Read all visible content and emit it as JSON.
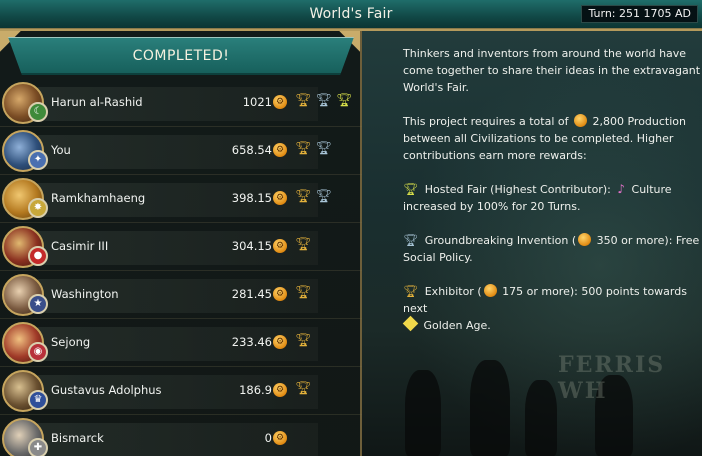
{
  "window": {
    "title": "World's Fair",
    "turn": "Turn: 251   1705 AD"
  },
  "banner": {
    "label": "COMPLETED!"
  },
  "civs": [
    {
      "name": "Harun al-Rashid",
      "score": "1021",
      "trophies": [
        "gold",
        "silver",
        "green"
      ]
    },
    {
      "name": "You",
      "score": "658.54",
      "trophies": [
        "gold",
        "silver"
      ]
    },
    {
      "name": "Ramkhamhaeng",
      "score": "398.15",
      "trophies": [
        "gold",
        "silver"
      ]
    },
    {
      "name": "Casimir III",
      "score": "304.15",
      "trophies": [
        "gold"
      ]
    },
    {
      "name": "Washington",
      "score": "281.45",
      "trophies": [
        "gold"
      ]
    },
    {
      "name": "Sejong",
      "score": "233.46",
      "trophies": [
        "gold"
      ]
    },
    {
      "name": "Gustavus Adolphus",
      "score": "186.9",
      "trophies": [
        "gold"
      ]
    },
    {
      "name": "Bismarck",
      "score": "0",
      "trophies": []
    }
  ],
  "info": {
    "intro": "Thinkers and inventors from around the world have come together to share their ideas in the extravagant World's Fair.",
    "req_a": "This project requires a total of",
    "req_b": "2,800 Production between all Civilizations to be completed.  Higher contributions earn more rewards:",
    "hosted_a": "Hosted Fair (Highest Contributor):",
    "hosted_b": "Culture increased by 100% for 20 Turns.",
    "ground_a": "Groundbreaking Invention (",
    "ground_b": "350 or more): Free Social Policy.",
    "exhib_a": "Exhibitor (",
    "exhib_b": "175 or more): 500 points towards next",
    "exhib_c": "Golden Age."
  },
  "scene": {
    "sign": "FERRIS WH"
  },
  "colors": {
    "accent": "#1f6d6a",
    "gold": "#c9ac6a",
    "production": "#e08a12"
  }
}
